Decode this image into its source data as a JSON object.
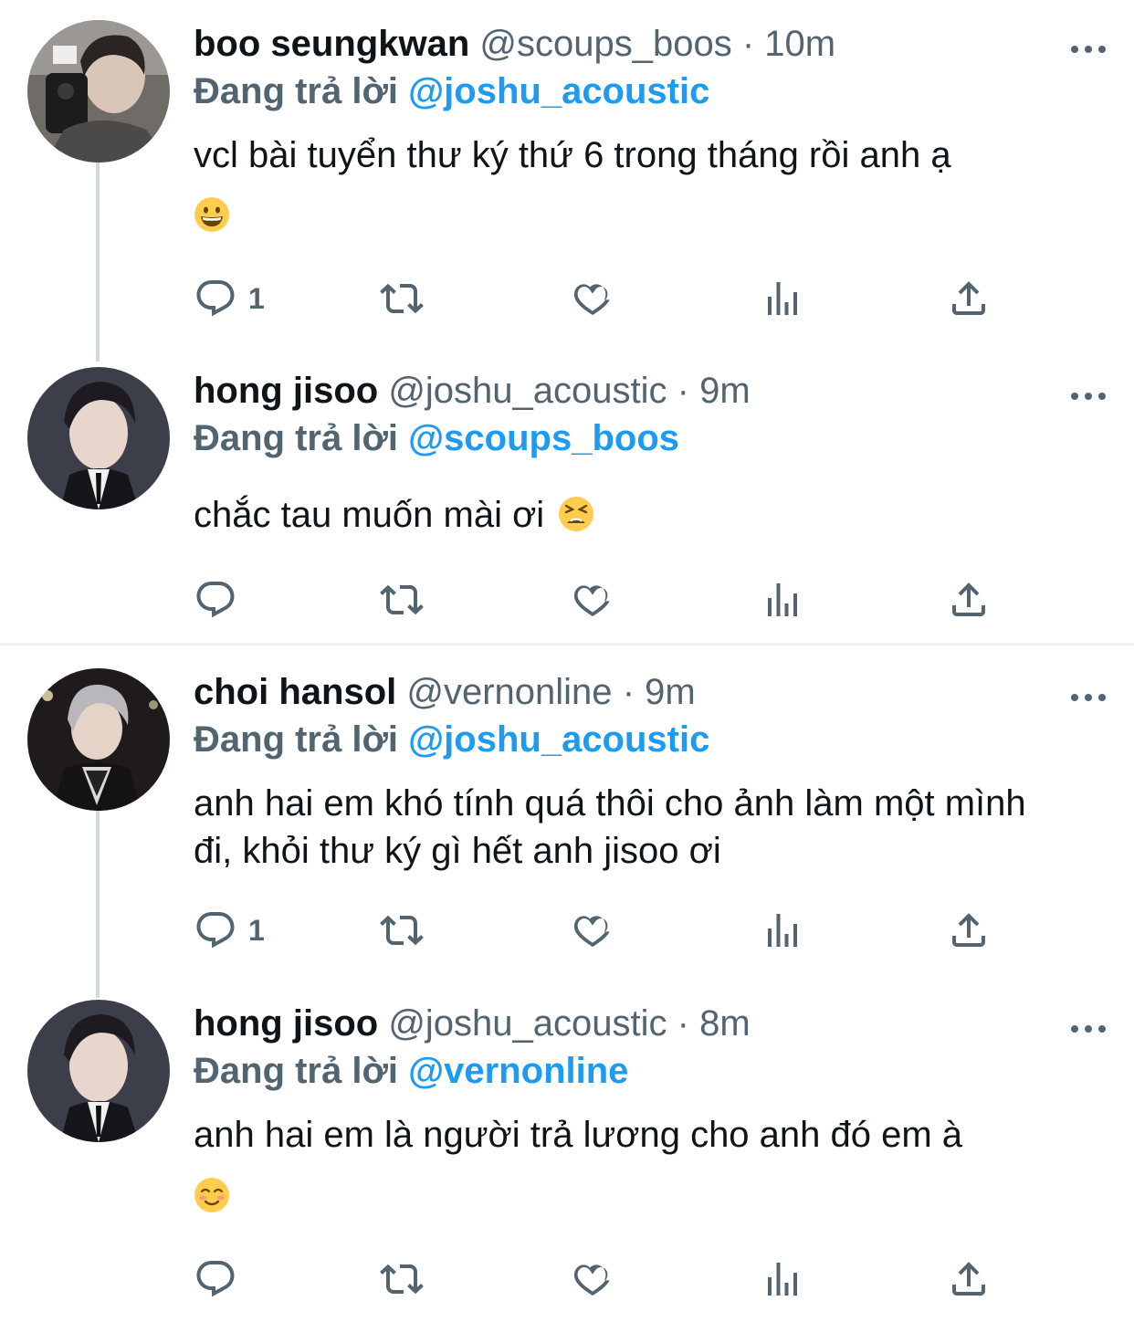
{
  "colors": {
    "text": "#0f1419",
    "muted": "#536471",
    "mention": "#1d9bf0",
    "thread_line": "#cfd9de"
  },
  "tweets": [
    {
      "name": "boo seungkwan",
      "handle": "@scoups_boos",
      "time": "10m",
      "replying_label": "Đang trả lời",
      "replying_to": "@joshu_acoustic",
      "text": "vcl bài tuyển thư ký thứ 6 trong tháng rồi anh ạ",
      "emoji": "grinning-face-emoji",
      "reply_count": "1"
    },
    {
      "name": "hong jisoo",
      "handle": "@joshu_acoustic",
      "time": "9m",
      "replying_label": "Đang trả lời",
      "replying_to": "@scoups_boos",
      "text": "chắc tau muốn mài ơi",
      "emoji": "tired-face-emoji",
      "reply_count": ""
    },
    {
      "name": "choi hansol",
      "handle": "@vernonline",
      "time": "9m",
      "replying_label": "Đang trả lời",
      "replying_to": "@joshu_acoustic",
      "text": "anh hai em khó tính quá thôi cho ảnh làm một mình đi, khỏi thư ký gì hết anh jisoo ơi",
      "emoji": "",
      "reply_count": "1"
    },
    {
      "name": "hong jisoo",
      "handle": "@joshu_acoustic",
      "time": "8m",
      "replying_label": "Đang trả lời",
      "replying_to": "@vernonline",
      "text": "anh hai em là người trả lương cho anh đó em à",
      "emoji": "smiling-face-emoji",
      "reply_count": ""
    }
  ],
  "icons": {
    "more": "more-icon",
    "reply": "reply-icon",
    "retweet": "retweet-icon",
    "like": "like-icon",
    "views": "views-icon",
    "share": "share-icon"
  }
}
